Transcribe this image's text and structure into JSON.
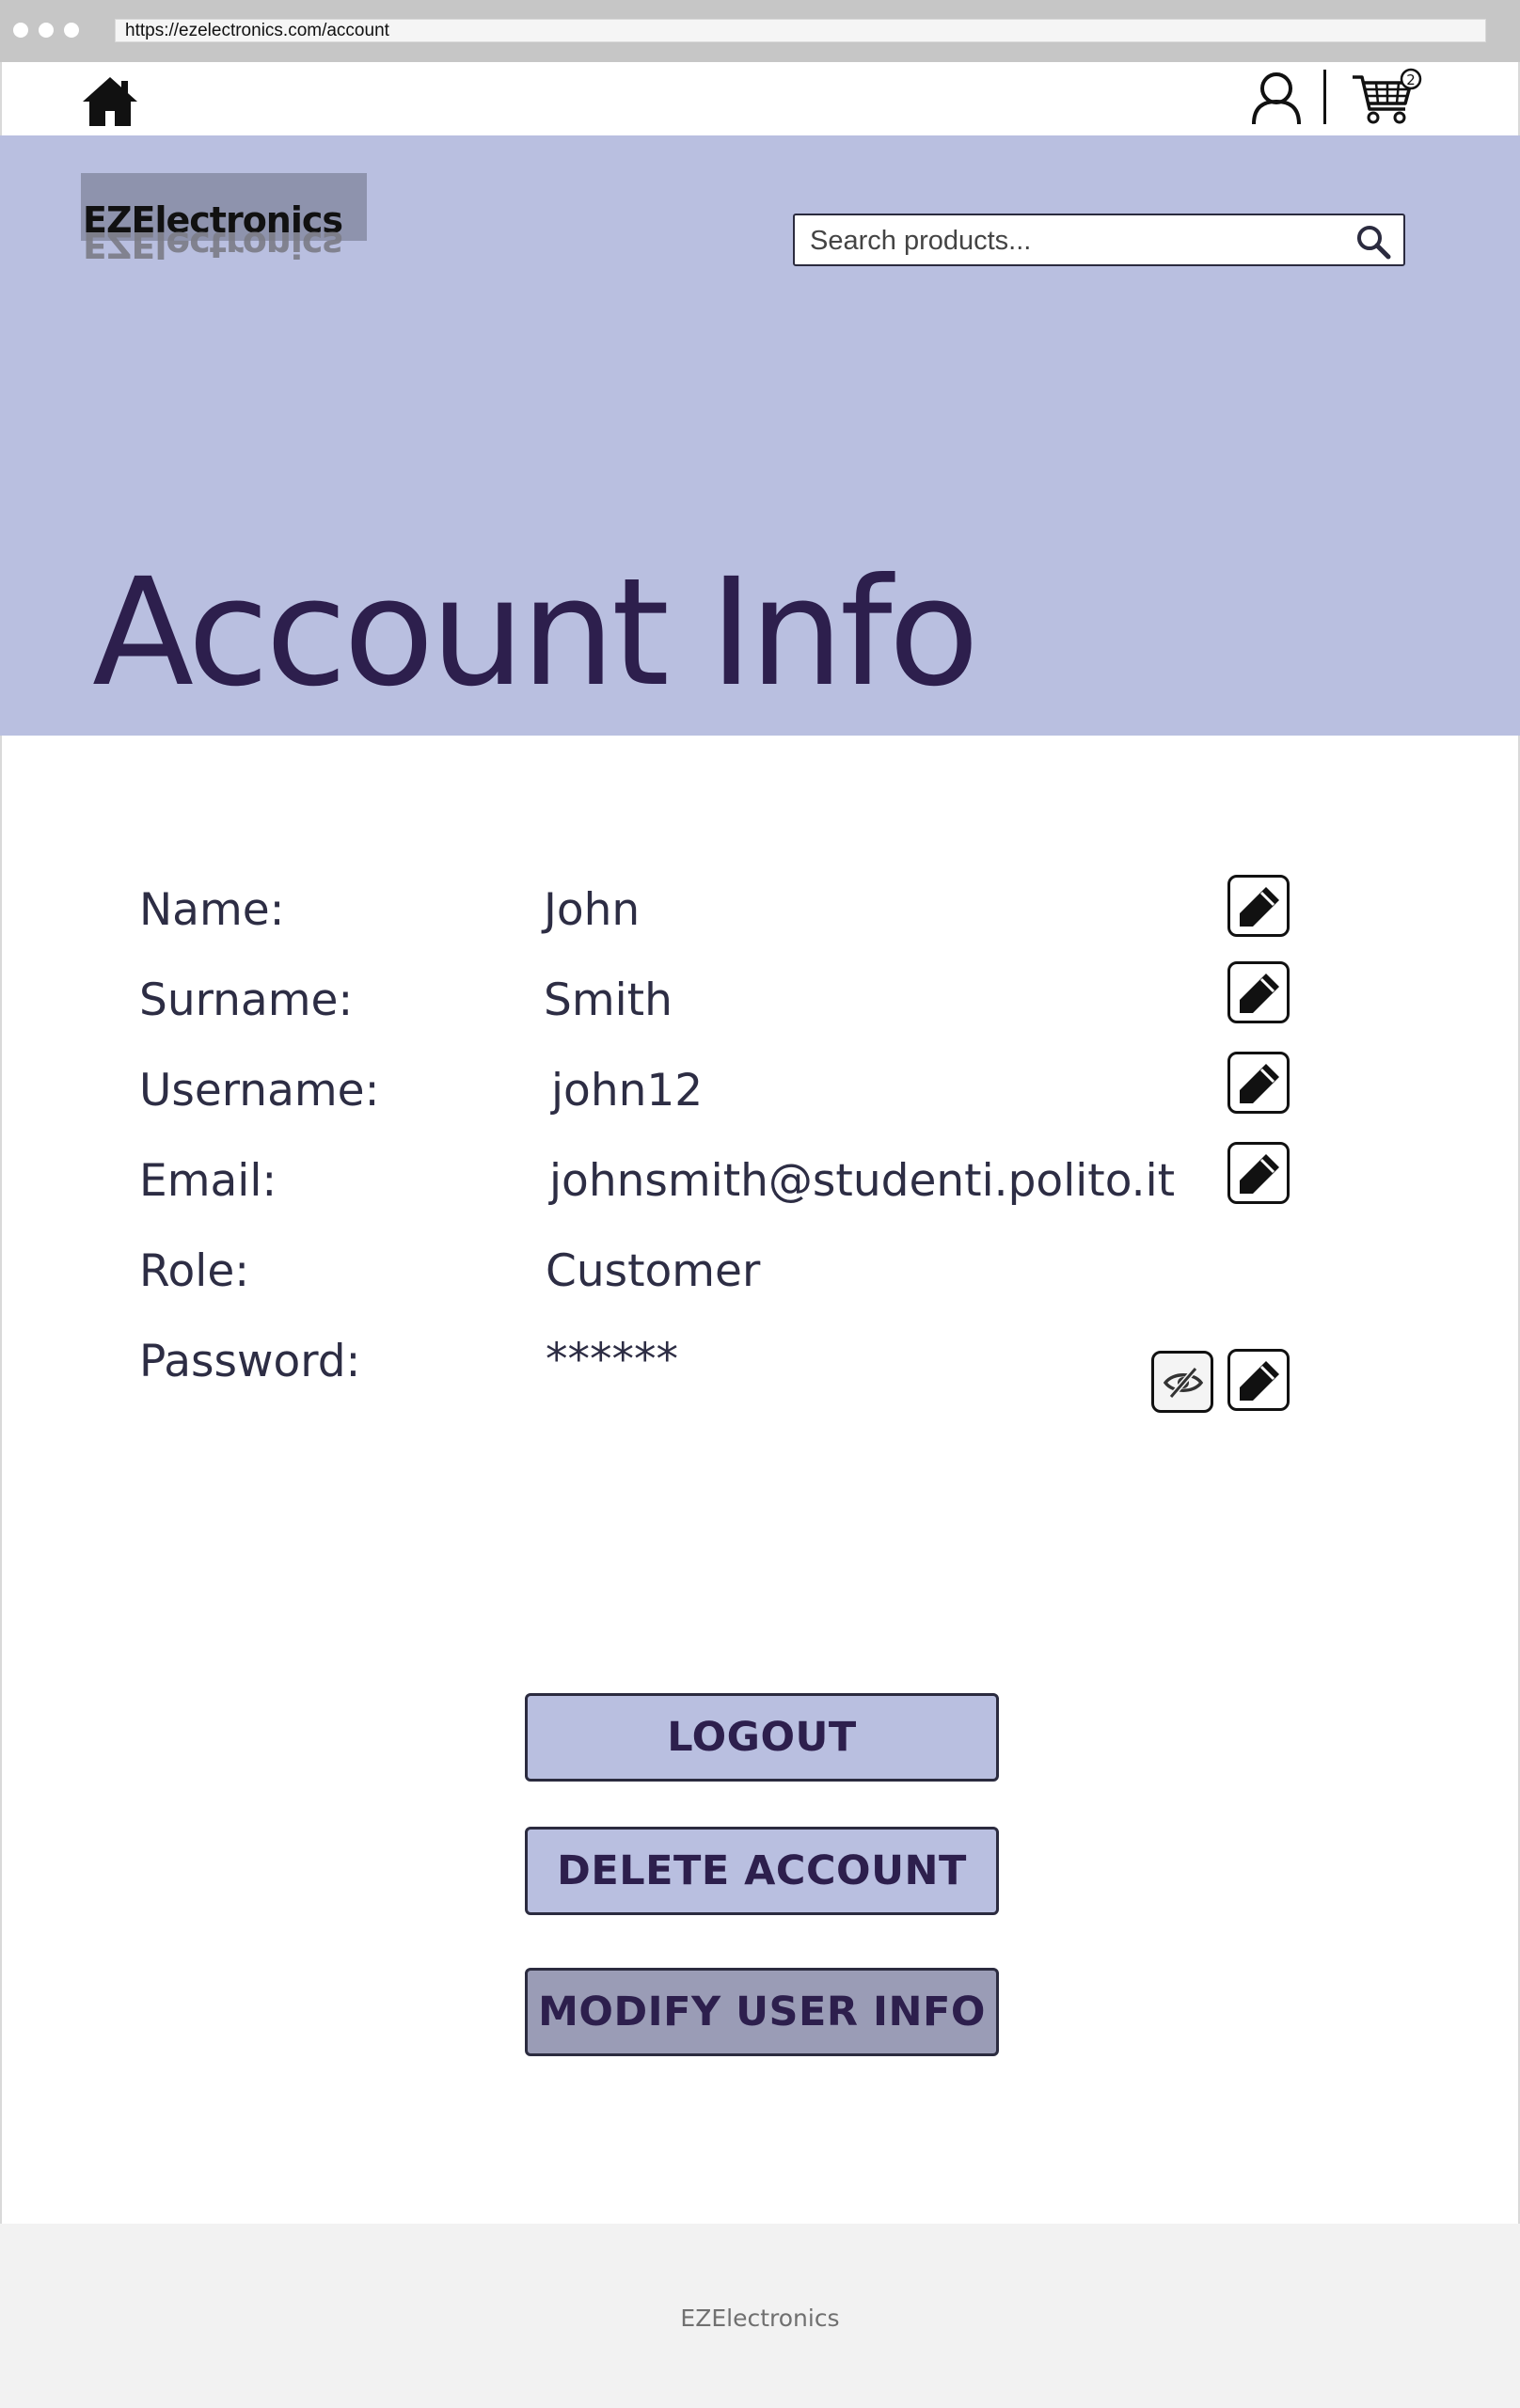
{
  "browser": {
    "url": "https://ezelectronics.com/account"
  },
  "nav": {
    "cart_count": "2"
  },
  "header": {
    "logo_text": "EZElectronics",
    "search_placeholder": "Search products..."
  },
  "page": {
    "title": "Account Info"
  },
  "account": {
    "fields": [
      {
        "label": "Name:",
        "value": "John"
      },
      {
        "label": "Surname:",
        "value": "Smith"
      },
      {
        "label": "Username:",
        "value": "john12"
      },
      {
        "label": "Email:",
        "value": "johnsmith@studenti.polito.it"
      },
      {
        "label": "Role:",
        "value": "Customer"
      },
      {
        "label": "Password:",
        "value": "******"
      }
    ]
  },
  "actions": {
    "logout": "LOGOUT",
    "delete_account": "DELETE ACCOUNT",
    "modify_user_info": "MODIFY USER INFO"
  },
  "footer": {
    "text": "EZElectronics"
  },
  "colors": {
    "hero_bg": "#b9bfe0",
    "title_text": "#2d1f4d",
    "button_bg": "#b9bfe0",
    "button_dark_bg": "#9a9cb6",
    "footer_bg": "#f2f2f2"
  },
  "icons": {
    "home": "home-icon",
    "user": "user-icon",
    "cart": "cart-icon",
    "search": "search-icon",
    "edit": "pencil-icon",
    "visibility": "eye-off-icon"
  }
}
